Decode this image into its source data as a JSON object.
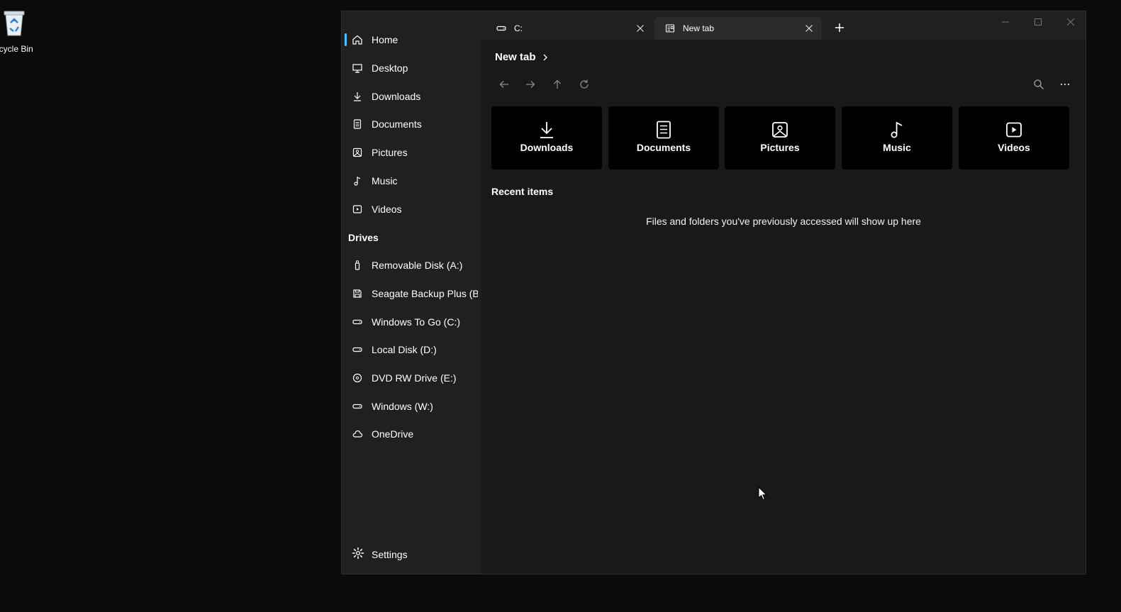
{
  "desktop": {
    "recycle_bin_label": "ecycle Bin",
    "recycle_bin_icon": "recycle-bin-icon"
  },
  "sidebar": {
    "items": [
      {
        "label": "Home",
        "icon": "home-icon",
        "active": true
      },
      {
        "label": "Desktop",
        "icon": "desktop-icon"
      },
      {
        "label": "Downloads",
        "icon": "download-icon"
      },
      {
        "label": "Documents",
        "icon": "document-icon"
      },
      {
        "label": "Pictures",
        "icon": "picture-icon"
      },
      {
        "label": "Music",
        "icon": "music-icon"
      },
      {
        "label": "Videos",
        "icon": "video-icon"
      }
    ],
    "drives_title": "Drives",
    "drives": [
      {
        "label": "Removable Disk (A:)",
        "icon": "usb-drive-icon"
      },
      {
        "label": "Seagate Backup Plus (B:)",
        "icon": "save-disk-icon"
      },
      {
        "label": "Windows To Go (C:)",
        "icon": "hard-drive-icon"
      },
      {
        "label": "Local Disk (D:)",
        "icon": "hard-drive-icon"
      },
      {
        "label": "DVD RW Drive (E:)",
        "icon": "disc-icon"
      },
      {
        "label": "Windows (W:)",
        "icon": "hard-drive-icon"
      },
      {
        "label": "OneDrive",
        "icon": "cloud-icon"
      }
    ],
    "settings_label": "Settings"
  },
  "tabs": [
    {
      "label": "C:",
      "icon": "hard-drive-icon",
      "active": false
    },
    {
      "label": "New tab",
      "icon": "new-tab-icon",
      "active": true
    }
  ],
  "breadcrumb": {
    "current": "New tab"
  },
  "cards": [
    {
      "label": "Downloads",
      "icon": "download-icon"
    },
    {
      "label": "Documents",
      "icon": "document-icon"
    },
    {
      "label": "Pictures",
      "icon": "picture-icon"
    },
    {
      "label": "Music",
      "icon": "music-icon"
    },
    {
      "label": "Videos",
      "icon": "video-icon"
    }
  ],
  "recent": {
    "title": "Recent items",
    "empty_message": "Files and folders you've previously accessed will show up here"
  },
  "colors": {
    "accent": "#4cc2ff",
    "sidebar_bg": "#202020",
    "content_bg": "#191919",
    "card_bg": "#000000"
  }
}
